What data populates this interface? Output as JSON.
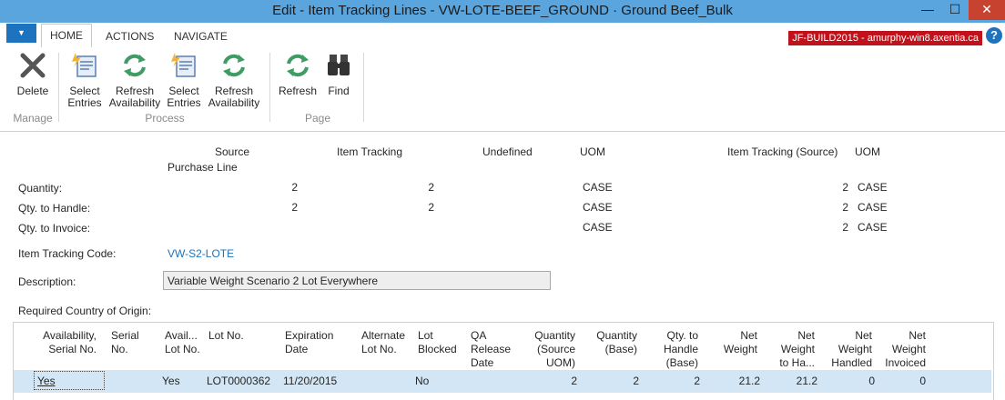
{
  "window": {
    "title": "Edit - Item Tracking Lines - VW-LOTE-BEEF_GROUND · Ground Beef_Bulk",
    "minimize_glyph": "—",
    "maximize_glyph": "☐",
    "close_glyph": "✕"
  },
  "tabs": [
    "HOME",
    "ACTIONS",
    "NAVIGATE"
  ],
  "server_label": "JF-BUILD2015 - amurphy-win8.axentia.ca",
  "help_glyph": "?",
  "menu_glyph": "▼",
  "ribbon": {
    "buttons": [
      {
        "label": "Delete",
        "icon": "delete-x-icon"
      },
      {
        "label": "Select Entries",
        "icon": "select-entries-icon"
      },
      {
        "label": "Refresh Availability",
        "icon": "refresh-icon"
      },
      {
        "label": "Select Entries",
        "icon": "select-entries-icon"
      },
      {
        "label": "Refresh Availability",
        "icon": "refresh-icon"
      },
      {
        "label": "Refresh",
        "icon": "refresh-icon"
      },
      {
        "label": "Find",
        "icon": "binoculars-icon"
      }
    ],
    "groups": [
      "Manage",
      "Process",
      "Page"
    ]
  },
  "summary": {
    "col_source": "Source",
    "col_source_sub": "Purchase Line",
    "col_item_tracking": "Item Tracking",
    "col_undefined": "Undefined",
    "col_uom": "UOM",
    "col_item_tracking_source": "Item Tracking (Source)",
    "col_uom2": "UOM",
    "rows": [
      {
        "label": "Quantity:",
        "source": "2",
        "tracking": "2",
        "uom": "CASE",
        "tracking_source": "2",
        "uom2": "CASE"
      },
      {
        "label": "Qty. to Handle:",
        "source": "2",
        "tracking": "2",
        "uom": "CASE",
        "tracking_source": "2",
        "uom2": "CASE"
      },
      {
        "label": "Qty. to Invoice:",
        "source": "",
        "tracking": "",
        "uom": "CASE",
        "tracking_source": "2",
        "uom2": "CASE"
      }
    ]
  },
  "fields": {
    "tracking_code_label": "Item Tracking Code:",
    "tracking_code_value": "VW-S2-LOTE",
    "description_label": "Description:",
    "description_value": "Variable Weight Scenario 2 Lot Everywhere",
    "country_label": "Required Country of Origin:"
  },
  "grid": {
    "headers": [
      "Availability, Serial No.",
      "Serial No.",
      "Avail... Lot No.",
      "Lot No.",
      "Expiration Date",
      "Alternate Lot No.",
      "Lot Blocked",
      "QA Release Date",
      "Quantity (Source UOM)",
      "Quantity (Base)",
      "Qty. to Handle (Base)",
      "Net Weight",
      "Net Weight to Ha...",
      "Net Weight Handled",
      "Net Weight Invoiced"
    ],
    "rows": [
      {
        "availability_serial": "Yes",
        "serial_no": "",
        "avail_lot": "Yes",
        "lot_no": "LOT0000362",
        "expiration": "11/20/2015",
        "alternate_lot": "",
        "lot_blocked": "No",
        "qa_release": "",
        "quantity_source": "2",
        "quantity_base": "2",
        "qty_to_handle_base": "2",
        "net_weight": "21.2",
        "net_weight_to_handle": "21.2",
        "net_weight_handled": "0",
        "net_weight_invoiced": "0"
      }
    ]
  },
  "colors": {
    "titlebar": "#5aa5de",
    "accent": "#1e73be",
    "server_badge": "#c0121a",
    "selected_row": "#d2e6f5"
  }
}
